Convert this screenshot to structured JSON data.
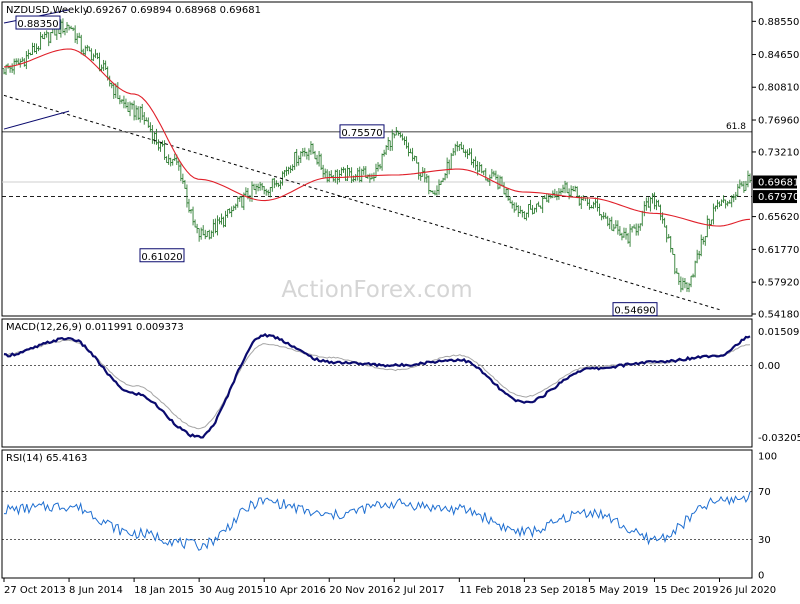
{
  "header": {
    "symbol": "NZDUSD,Weekly",
    "ohlc": "0.69267 0.69894 0.68968 0.69681"
  },
  "watermark": "ActionForex.com",
  "colors": {
    "bars": "#2e7d32",
    "ma": "#e0202a",
    "macd": "#0a0a6e",
    "macd_signal": "#a6a6a6",
    "rsi": "#1f6fd1",
    "price_tag_bg": "#000000",
    "grid": "#000000"
  },
  "chart_data": [
    {
      "type": "candlestick",
      "panel": "price",
      "title": "NZDUSD,Weekly",
      "ylim": [
        0.5418,
        0.9035
      ],
      "y_ticks": [
        "0.88550",
        "0.84650",
        "0.80810",
        "0.76960",
        "0.73210",
        "0.69681",
        "0.67970",
        "0.65620",
        "0.61770",
        "0.57920",
        "0.54180"
      ],
      "x_ticks": [
        "27 Oct 2013",
        "8 Jun 2014",
        "18 Jan 2015",
        "30 Aug 2015",
        "10 Apr 2016",
        "20 Nov 2016",
        "2 Jul 2017",
        "11 Feb 2018",
        "23 Sep 2018",
        "5 May 2019",
        "15 Dec 2019",
        "26 Jul 2020"
      ],
      "current_price": "0.69681",
      "horizontal_lines": [
        {
          "value": 0.7557,
          "style": "solid",
          "label": "61.8"
        },
        {
          "value": 0.6797,
          "style": "dashed",
          "label": "0.67970"
        }
      ],
      "trendlines": [
        {
          "from": [
            "2013-10-27",
            0.7985
          ],
          "to": [
            "2020-07-26",
            0.5469
          ],
          "style": "dashed"
        },
        {
          "from": [
            "2013-10-27",
            0.8835
          ],
          "to": [
            "2014-06-08",
            0.899
          ],
          "style": "solid"
        },
        {
          "from": [
            "2013-10-27",
            0.759
          ],
          "to": [
            "2014-06-08",
            0.78
          ],
          "style": "solid"
        }
      ],
      "annotations": [
        {
          "text": "0.88350",
          "value": 0.8835
        },
        {
          "text": "0.75570",
          "value": 0.7557
        },
        {
          "text": "0.61020",
          "value": 0.6102
        },
        {
          "text": "0.54690",
          "value": 0.5469
        }
      ],
      "series": [
        {
          "kind": "ohlc",
          "x": [
            "2013-10-27",
            "2014-06-08",
            "2014-08-03",
            "2015-01-18",
            "2015-06-07",
            "2015-08-30",
            "2016-04-10",
            "2016-09-11",
            "2016-11-20",
            "2017-04-16",
            "2017-07-02",
            "2017-11-19",
            "2018-02-11",
            "2018-06-03",
            "2018-09-23",
            "2019-02-10",
            "2019-05-05",
            "2019-09-08",
            "2019-12-15",
            "2020-03-22",
            "2020-07-26",
            "2020-11-08"
          ],
          "values": [
            0.83,
            0.88,
            0.85,
            0.78,
            0.72,
            0.635,
            0.69,
            0.735,
            0.705,
            0.705,
            0.75,
            0.69,
            0.735,
            0.7,
            0.662,
            0.69,
            0.67,
            0.632,
            0.675,
            0.575,
            0.67,
            0.697
          ]
        },
        {
          "kind": "moving_average",
          "x": [
            "2013-10-27",
            "2014-06-08",
            "2015-01-18",
            "2015-08-30",
            "2016-04-10",
            "2016-11-20",
            "2017-07-02",
            "2018-02-11",
            "2018-09-23",
            "2019-05-05",
            "2019-12-15",
            "2020-07-26",
            "2020-11-08"
          ],
          "values": [
            0.832,
            0.853,
            0.8,
            0.7,
            0.675,
            0.702,
            0.705,
            0.712,
            0.685,
            0.678,
            0.66,
            0.645,
            0.653
          ]
        }
      ]
    },
    {
      "type": "line",
      "panel": "macd",
      "title": "MACD(12,26,9) 0.011991 0.009373",
      "ylim": [
        -0.035,
        0.018
      ],
      "y_ticks": [
        "0.015093",
        "0.00",
        "-0.032057"
      ],
      "x": [
        "2013-10-27",
        "2014-06-08",
        "2015-01-18",
        "2015-08-30",
        "2016-04-10",
        "2016-11-20",
        "2017-07-02",
        "2018-02-11",
        "2018-09-23",
        "2019-05-05",
        "2019-12-15",
        "2020-07-26",
        "2020-11-08"
      ],
      "series": [
        {
          "values": [
            0.0045,
            0.012,
            -0.0125,
            -0.032,
            0.0135,
            0.0015,
            0.0,
            0.0025,
            -0.0165,
            -0.0015,
            0.0015,
            0.0045,
            0.0125
          ]
        },
        {
          "values": [
            0.005,
            0.011,
            -0.009,
            -0.028,
            0.0095,
            0.0035,
            -0.002,
            0.0045,
            -0.014,
            -0.0005,
            0.001,
            0.0045,
            0.0094
          ]
        }
      ]
    },
    {
      "type": "line",
      "panel": "rsi",
      "title": "RSI(14) 65.4163",
      "ylim": [
        0,
        100
      ],
      "y_ticks": [
        "100",
        "70",
        "30",
        "0"
      ],
      "x": [
        "2013-10-27",
        "2014-06-08",
        "2015-01-18",
        "2015-08-30",
        "2016-04-10",
        "2016-11-20",
        "2017-07-02",
        "2018-02-11",
        "2018-09-23",
        "2019-05-05",
        "2019-12-15",
        "2020-07-26",
        "2020-11-08"
      ],
      "series": [
        {
          "values": [
            55,
            58,
            35,
            25,
            62,
            50,
            60,
            55,
            36,
            53,
            30,
            62,
            65.4
          ]
        }
      ]
    }
  ]
}
